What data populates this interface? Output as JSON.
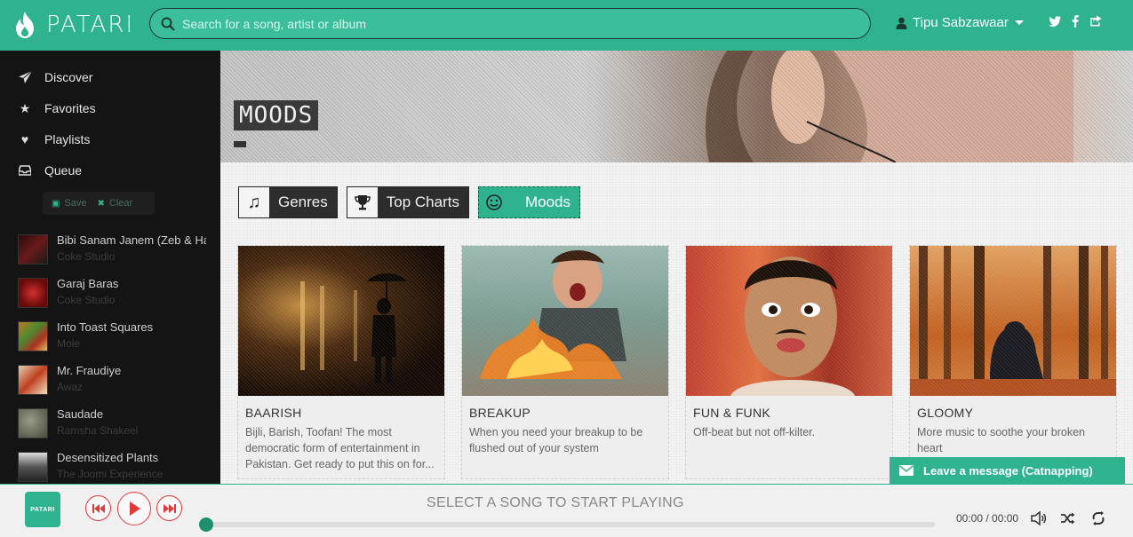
{
  "header": {
    "logo_text": "PATARI",
    "search_placeholder": "Search for a song, artist or album",
    "user_name": "Tipu Sabzawaar",
    "social": [
      "twitter-icon",
      "facebook-icon",
      "share-icon"
    ]
  },
  "sidebar": {
    "nav": [
      {
        "label": "Discover",
        "icon": "paper-plane-icon"
      },
      {
        "label": "Favorites",
        "icon": "star-icon"
      },
      {
        "label": "Playlists",
        "icon": "heart-icon"
      },
      {
        "label": "Queue",
        "icon": "inbox-icon"
      }
    ],
    "queue_actions": {
      "save": "Save",
      "clear": "Clear"
    },
    "queue": [
      {
        "title": "Bibi Sanam Janem (Zeb & Ha",
        "artist": "Coke Studio",
        "thumb": "#5a1a1a"
      },
      {
        "title": "Garaj Baras",
        "artist": "Coke Studio",
        "thumb": "#b02020"
      },
      {
        "title": "Into Toast Squares",
        "artist": "Mole",
        "thumb": "#8a5a20"
      },
      {
        "title": "Mr. Fraudiye",
        "artist": "Awaz",
        "thumb": "#c04020"
      },
      {
        "title": "Saudade",
        "artist": "Ramsha Shakeel",
        "thumb": "#6a6a5a"
      },
      {
        "title": "Desensitized Plants",
        "artist": "The Joomi Experience",
        "thumb": "#3a3a3a"
      }
    ]
  },
  "main": {
    "banner_title": "MOODS",
    "tabs": [
      {
        "label": "Genres",
        "icon": "music-note-icon",
        "active": false
      },
      {
        "label": "Top Charts",
        "icon": "trophy-icon",
        "active": false
      },
      {
        "label": "Moods",
        "icon": "smiley-icon",
        "active": true
      }
    ],
    "cards": [
      {
        "title": "BAARISH",
        "desc": "Bijli, Barish, Toofan! The most democratic form of entertainment in Pakistan. Get ready to put this on for..."
      },
      {
        "title": "BREAKUP",
        "desc": "When you need your breakup to be flushed out of your system"
      },
      {
        "title": "FUN & FUNK",
        "desc": "Off-beat but not off-kilter."
      },
      {
        "title": "GLOOMY",
        "desc": "More music to soothe your broken heart"
      }
    ]
  },
  "chat": {
    "label": "Leave a message (Catnapping)"
  },
  "player": {
    "logo": "PATARI",
    "status": "SELECT A SONG TO START PLAYING",
    "time": "00:00 / 00:00",
    "progress": 0
  },
  "colors": {
    "accent": "#2fb38f",
    "player_red": "#e03a3a",
    "sidebar_bg": "#141414"
  }
}
